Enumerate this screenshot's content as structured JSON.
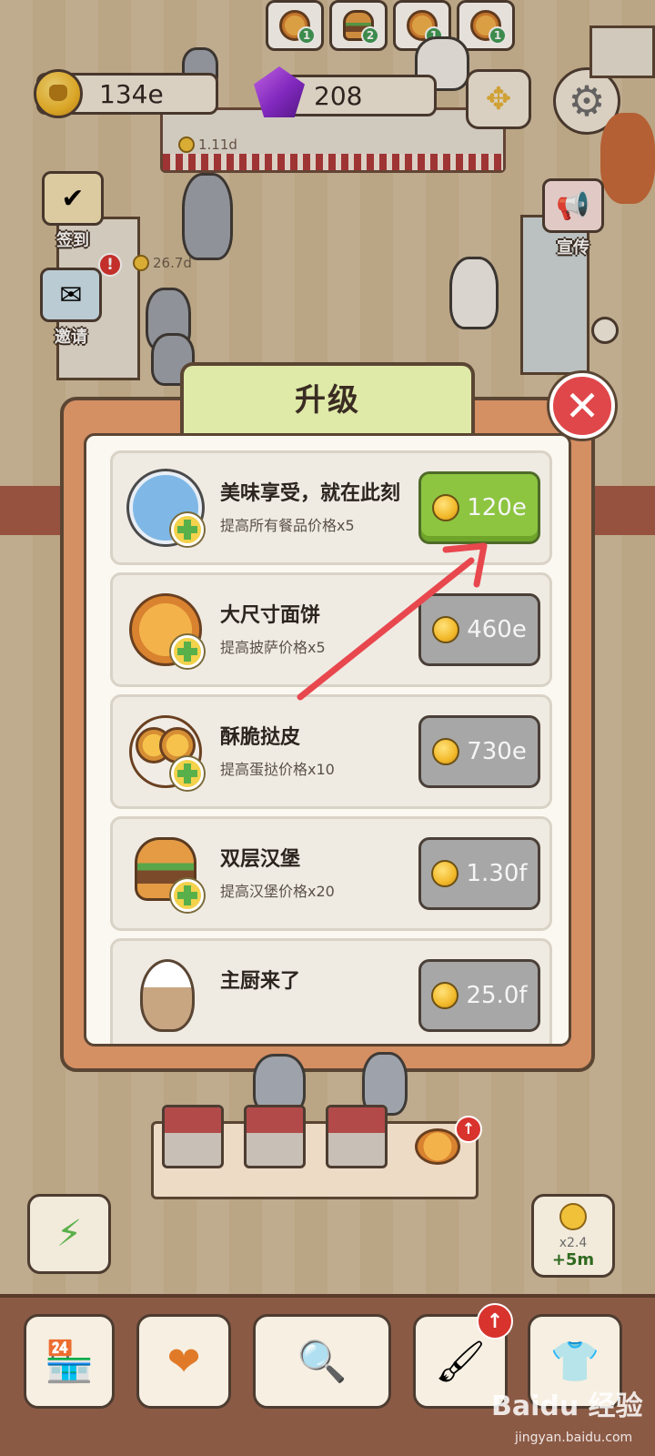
{
  "hud": {
    "coins": "134e",
    "gems": "208",
    "counter_value": "1.11d",
    "side_value": "26.7d"
  },
  "orders": [
    {
      "food": "pizza",
      "count": "1"
    },
    {
      "food": "burger",
      "count": "2"
    },
    {
      "food": "pizza",
      "count": "1"
    },
    {
      "food": "pizza",
      "count": "1"
    }
  ],
  "side_buttons": {
    "checkin_label": "签到",
    "invite_label": "邀请",
    "promote_label": "宣传"
  },
  "upgrade_modal": {
    "title": "升级",
    "close_icon": "close-icon",
    "items": [
      {
        "title": "美味享受，就在此刻",
        "desc": "提高所有餐品价格x5",
        "price": "120e",
        "state": "affordable",
        "icon": "plate-icon"
      },
      {
        "title": "大尺寸面饼",
        "desc": "提高披萨价格x5",
        "price": "460e",
        "state": "locked",
        "icon": "pizza-icon"
      },
      {
        "title": "酥脆挞皮",
        "desc": "提高蛋挞价格x10",
        "price": "730e",
        "state": "locked",
        "icon": "egg-tart-icon"
      },
      {
        "title": "双层汉堡",
        "desc": "提高汉堡价格x20",
        "price": "1.30f",
        "state": "locked",
        "icon": "burger-icon"
      },
      {
        "title": "主厨来了",
        "desc": "",
        "price": "25.0f",
        "state": "locked",
        "icon": "chef-cat-icon"
      }
    ]
  },
  "income_boost": {
    "multiplier": "x2.4",
    "duration": "+5m"
  },
  "bottom_nav": [
    "shop-icon",
    "paw-heart-icon",
    "newspaper-search-icon",
    "paint-roller-icon",
    "tshirt-icon"
  ],
  "watermark": {
    "brand": "Baidu 经验",
    "url": "jingyan.baidu.com"
  },
  "colors": {
    "affordable_button": "#8dc540",
    "locked_button": "#a7a7a7",
    "annotation_arrow": "#e8474e",
    "close_button": "#e0474a"
  }
}
